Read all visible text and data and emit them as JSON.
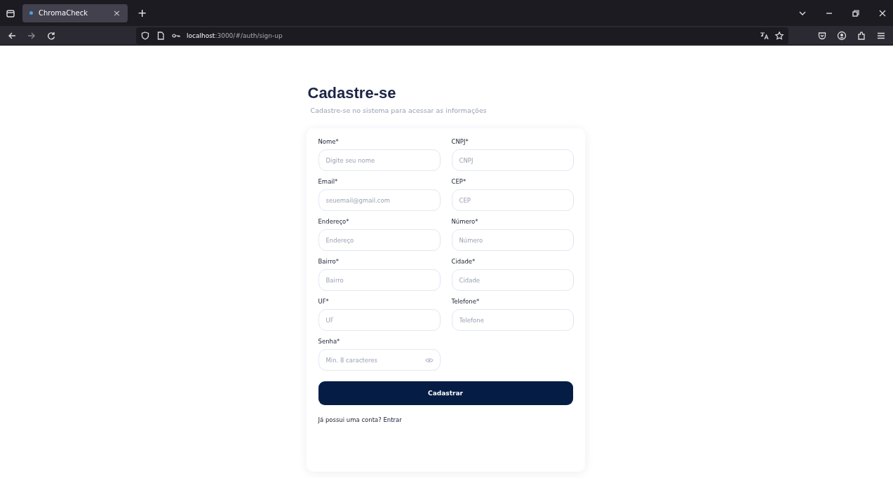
{
  "browser": {
    "tab": {
      "title": "ChromaCheck",
      "selected": true
    },
    "close_tab": "×",
    "new_tab": "+",
    "url_host": "localhost",
    "url_path": ":3000/#/auth/sign-up"
  },
  "page": {
    "title": "Cadastre-se",
    "subtitle": "Cadastre-se no sistema para acessar as informações"
  },
  "form": {
    "fields": [
      {
        "label": "Nome*",
        "placeholder": "Digite seu nome",
        "kind": "text"
      },
      {
        "label": "CNPJ*",
        "placeholder": "CNPJ",
        "kind": "text"
      },
      {
        "label": "Email*",
        "placeholder": "seuemail@gmail.com",
        "kind": "text"
      },
      {
        "label": "CEP*",
        "placeholder": "CEP",
        "kind": "text"
      },
      {
        "label": "Endereço*",
        "placeholder": "Endereço",
        "kind": "text"
      },
      {
        "label": "Número*",
        "placeholder": "Número",
        "kind": "text"
      },
      {
        "label": "Bairro*",
        "placeholder": "Bairro",
        "kind": "text"
      },
      {
        "label": "Cidade*",
        "placeholder": "Cidade",
        "kind": "text"
      },
      {
        "label": "UF*",
        "placeholder": "UF",
        "kind": "text"
      },
      {
        "label": "Telefone*",
        "placeholder": "Telefone",
        "kind": "text"
      },
      {
        "label": "Senha*",
        "placeholder": "Min. 8 caracteres",
        "kind": "password"
      }
    ],
    "submit": "Cadastrar",
    "footer_text": "Já possui uma conta?",
    "footer_link": "Entrar"
  }
}
